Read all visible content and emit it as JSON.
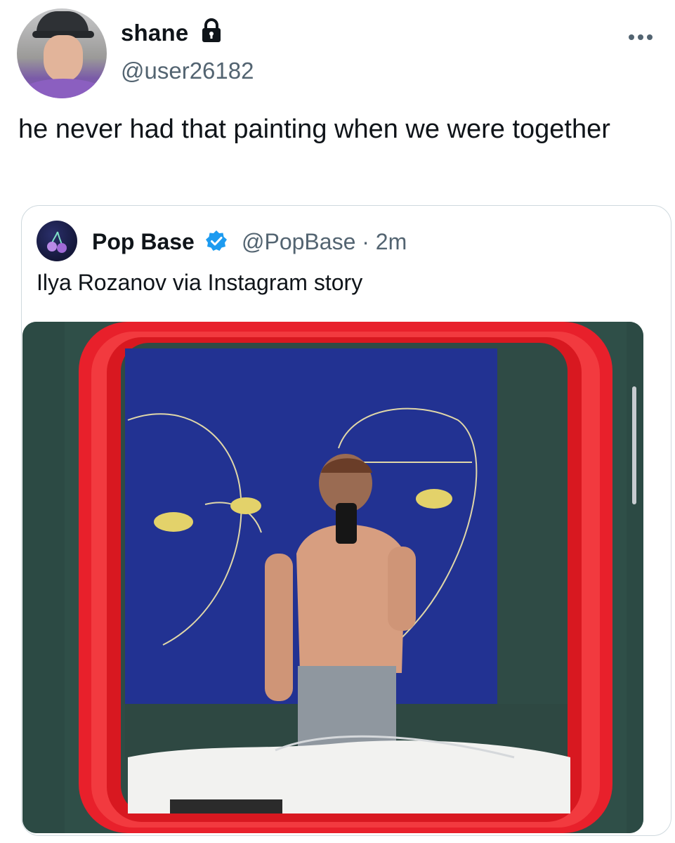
{
  "tweet": {
    "display_name": "shane",
    "handle": "@user26182",
    "text": "he never had that painting when we were together",
    "icons": {
      "lock": "lock-icon",
      "more": "more-options-icon"
    }
  },
  "quoted_tweet": {
    "display_name": "Pop Base",
    "handle": "@PopBase",
    "time": "2m",
    "text": "Ilya Rozanov via Instagram story",
    "verified_color": "#1d9bf0",
    "icons": {
      "verified": "verified-badge-icon"
    }
  },
  "colors": {
    "text_primary": "#0f1419",
    "text_secondary": "#536471",
    "border": "#cfd9de"
  }
}
